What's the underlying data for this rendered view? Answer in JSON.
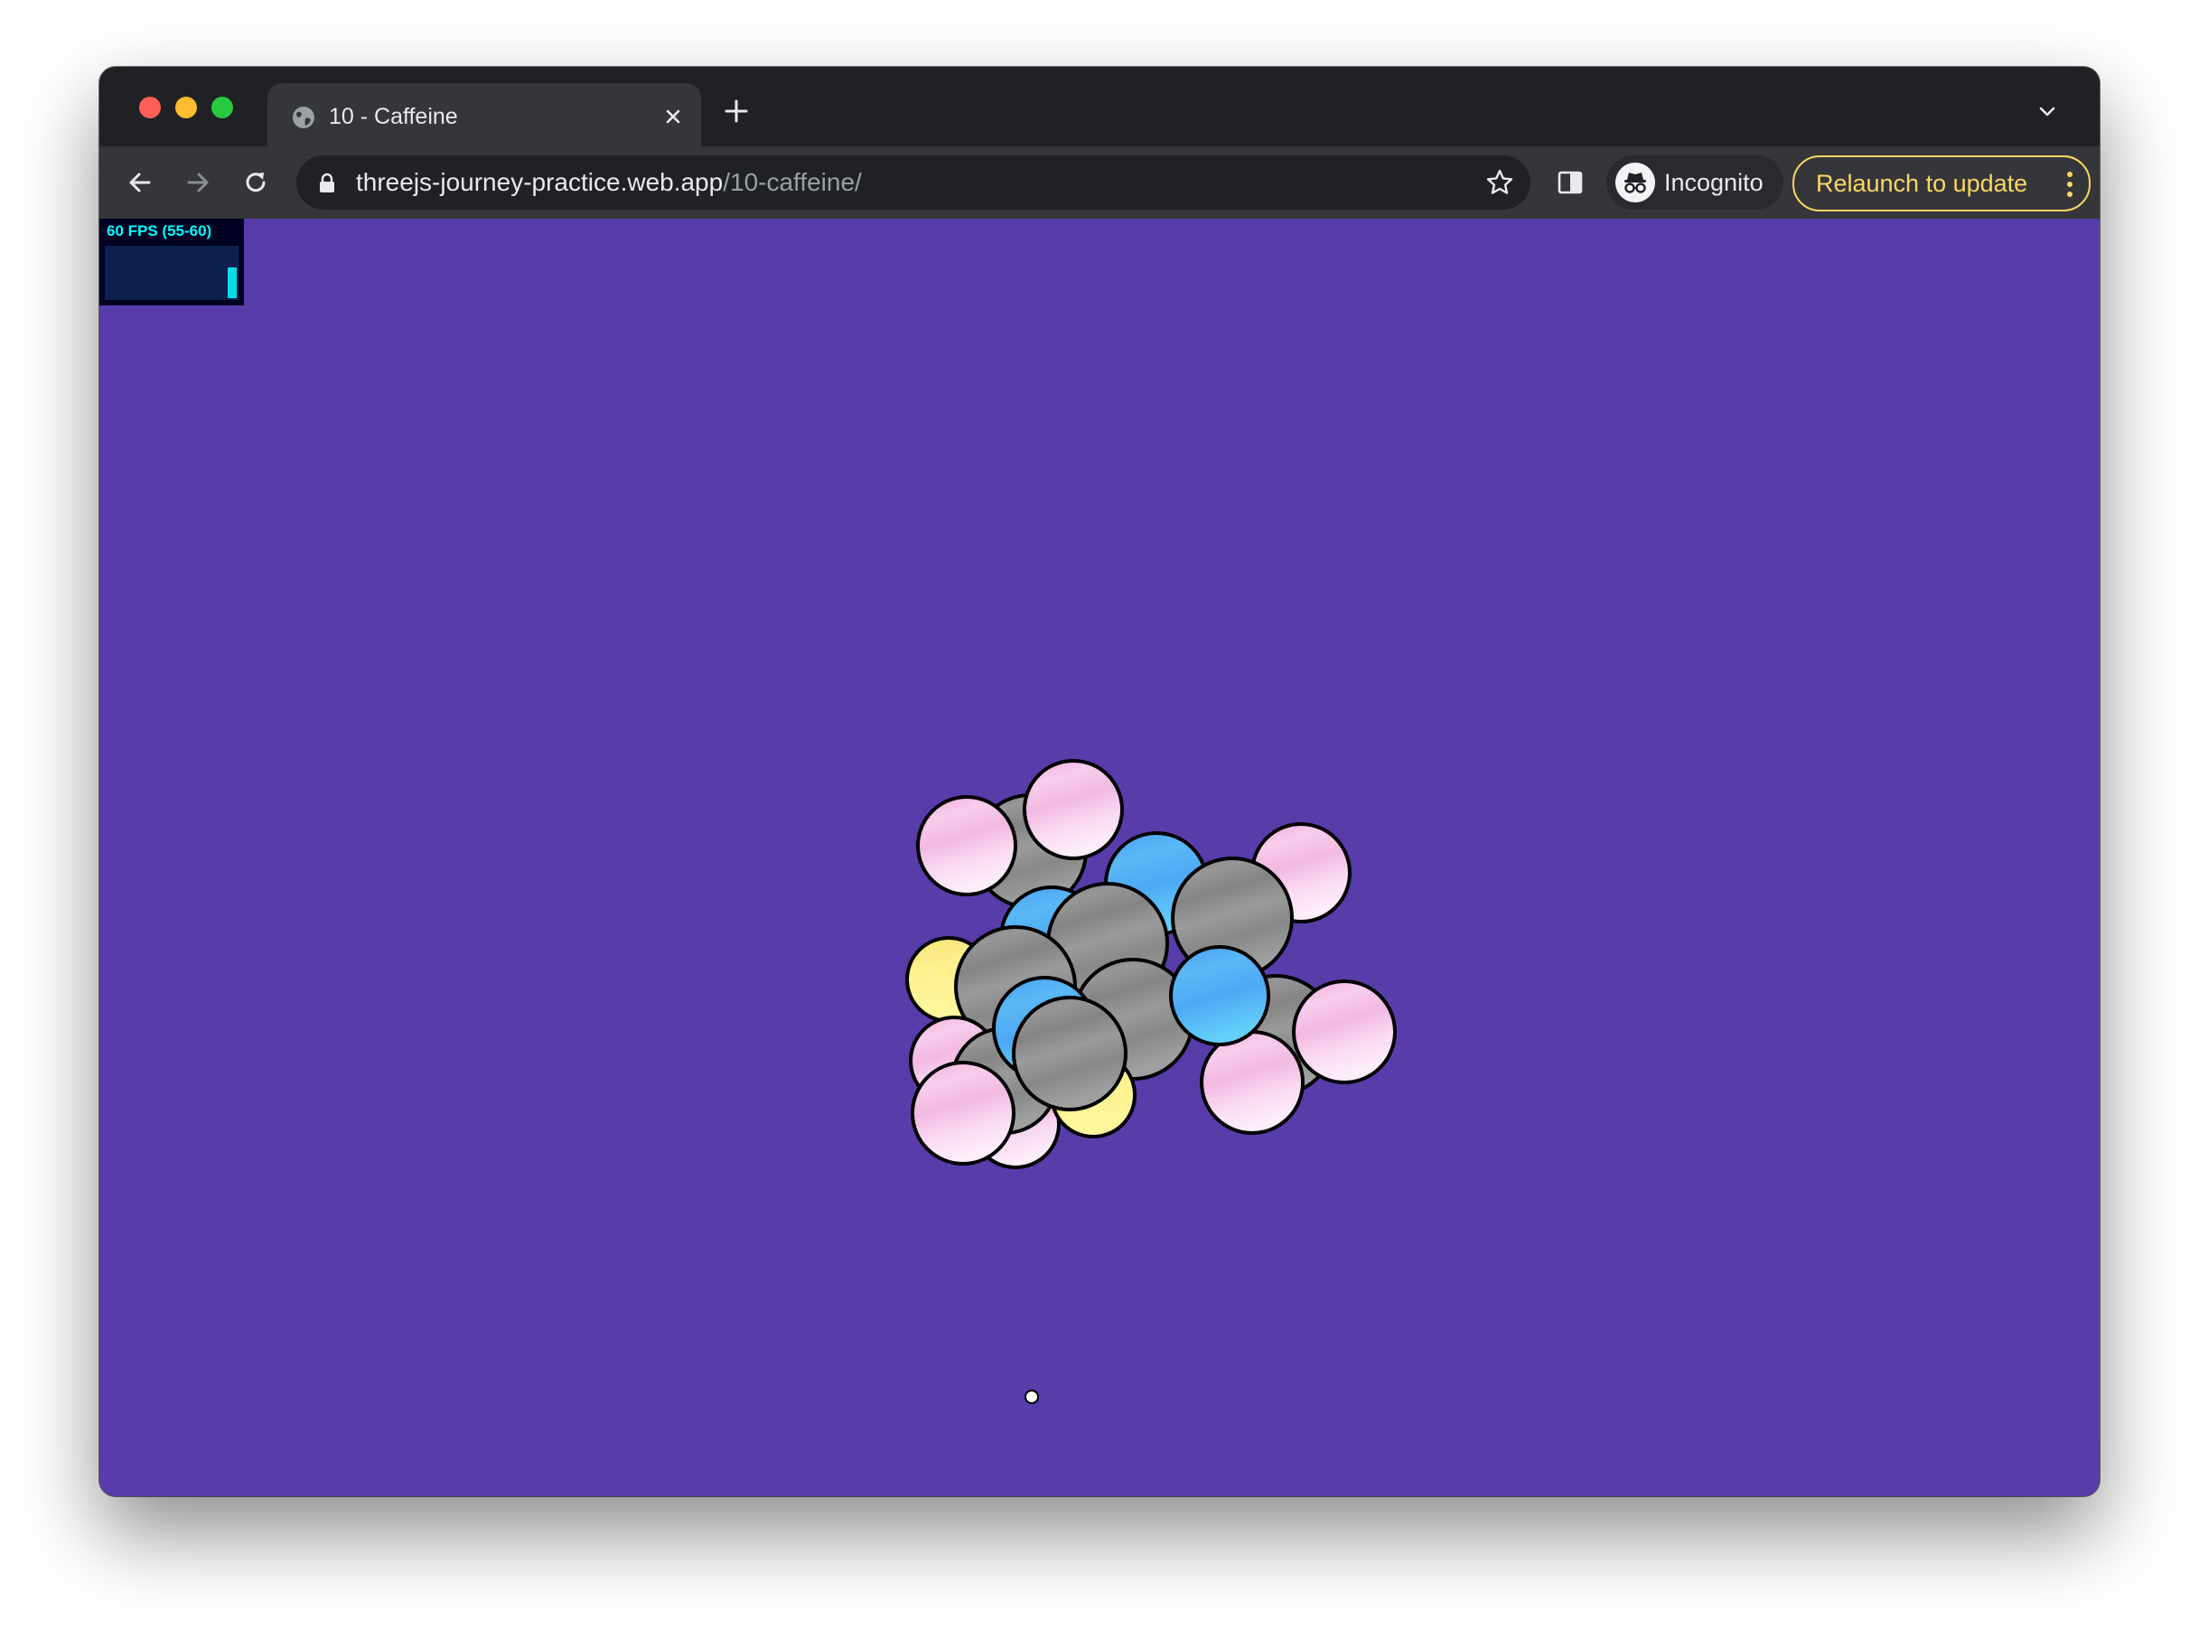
{
  "window": {
    "controls": [
      "close",
      "minimize",
      "zoom"
    ]
  },
  "tab": {
    "title": "10 - Caffeine",
    "icon": "globe-icon"
  },
  "toolbar": {
    "url_host": "threejs-journey-practice.web.app",
    "url_path": "/10-caffeine/",
    "incognito_label": "Incognito",
    "relaunch_label": "Relaunch to update"
  },
  "stats_panel": {
    "label": "60 FPS (55-60)",
    "fps_level": 0.6
  },
  "scene": {
    "background": "#583ca9",
    "atom_colors": {
      "carbon": "#8e8e8e",
      "nitrogen": "#4fb4f5",
      "oxygen": "#fbe77e",
      "hydrogen": "#f6c9ea"
    }
  }
}
